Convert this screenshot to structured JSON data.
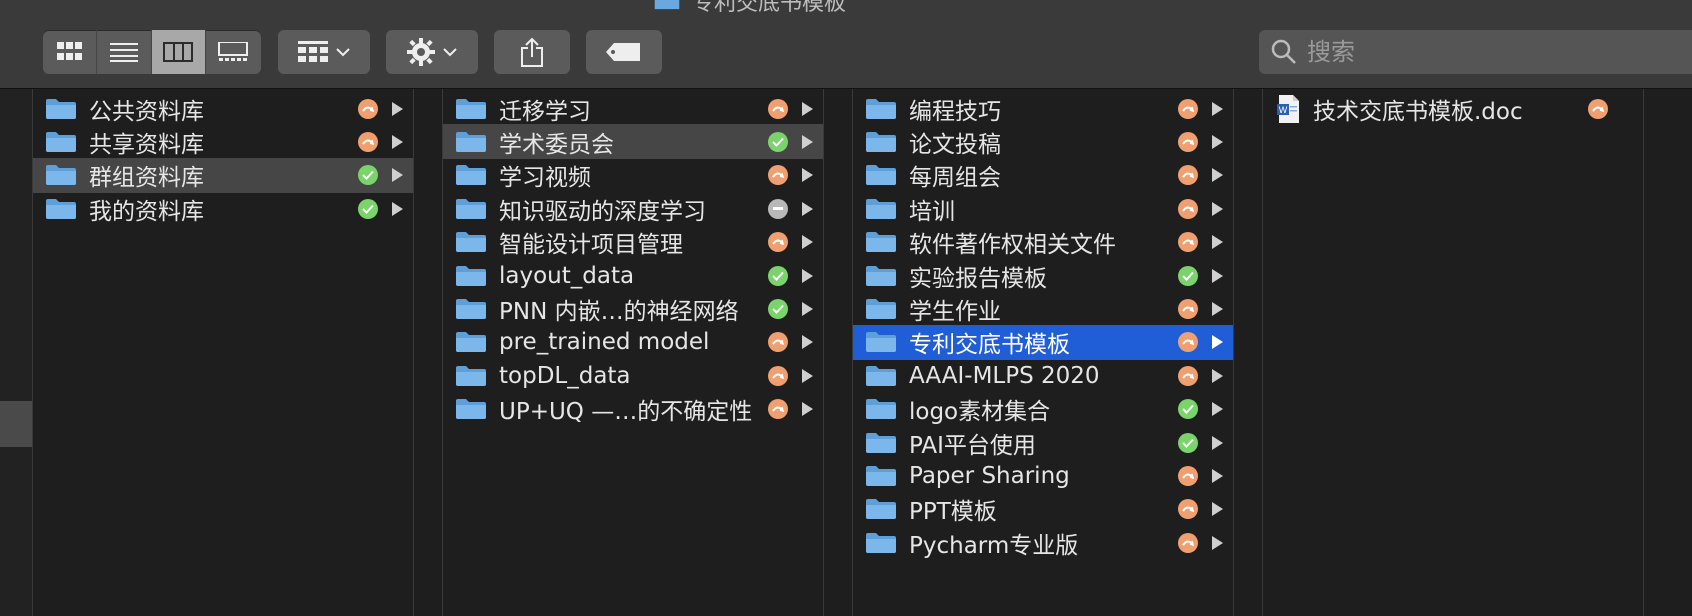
{
  "window": {
    "title": "专利交底书模板"
  },
  "toolbar": {
    "view_buttons": [
      "icon-view",
      "list-view",
      "column-view",
      "gallery-view"
    ],
    "active_view": "column-view",
    "group_button": "group-by",
    "action_button": "action-gear",
    "share_button": "share",
    "tag_button": "tags"
  },
  "search": {
    "placeholder": "搜索"
  },
  "columns": [
    {
      "items": [
        {
          "label": "公共资料库",
          "status": "sync",
          "selected": false
        },
        {
          "label": "共享资料库",
          "status": "sync",
          "selected": false
        },
        {
          "label": "群组资料库",
          "status": "ok",
          "selected": true
        },
        {
          "label": "我的资料库",
          "status": "ok",
          "selected": false
        }
      ]
    },
    {
      "items": [
        {
          "label": "迁移学习",
          "status": "sync",
          "selected": false
        },
        {
          "label": "学术委员会",
          "status": "ok",
          "selected": true
        },
        {
          "label": "学习视频",
          "status": "sync",
          "selected": false
        },
        {
          "label": "知识驱动的深度学习",
          "status": "gray",
          "selected": false
        },
        {
          "label": "智能设计项目管理",
          "status": "sync",
          "selected": false
        },
        {
          "label": "layout_data",
          "status": "ok",
          "selected": false
        },
        {
          "label": "PNN 内嵌…的神经网络",
          "status": "ok",
          "selected": false
        },
        {
          "label": "pre_trained model",
          "status": "sync",
          "selected": false
        },
        {
          "label": "topDL_data",
          "status": "sync",
          "selected": false
        },
        {
          "label": "UP+UQ —…的不确定性",
          "status": "sync",
          "selected": false
        }
      ]
    },
    {
      "items": [
        {
          "label": "编程技巧",
          "status": "sync",
          "selected": false
        },
        {
          "label": "论文投稿",
          "status": "sync",
          "selected": false
        },
        {
          "label": "每周组会",
          "status": "sync",
          "selected": false
        },
        {
          "label": "培训",
          "status": "sync",
          "selected": false
        },
        {
          "label": "软件著作权相关文件",
          "status": "sync",
          "selected": false
        },
        {
          "label": "实验报告模板",
          "status": "ok",
          "selected": false
        },
        {
          "label": "学生作业",
          "status": "sync",
          "selected": false
        },
        {
          "label": "专利交底书模板",
          "status": "sync",
          "selected": "blue"
        },
        {
          "label": "AAAI-MLPS 2020",
          "status": "sync",
          "selected": false
        },
        {
          "label": "logo素材集合",
          "status": "ok",
          "selected": false
        },
        {
          "label": "PAI平台使用",
          "status": "ok",
          "selected": false
        },
        {
          "label": "Paper Sharing",
          "status": "sync",
          "selected": false
        },
        {
          "label": "PPT模板",
          "status": "sync",
          "selected": false
        },
        {
          "label": "Pycharm专业版",
          "status": "sync",
          "selected": false
        }
      ]
    },
    {
      "files": [
        {
          "label": "技术交底书模板.doc",
          "status": "sync",
          "icon": "word-doc-icon"
        }
      ]
    }
  ],
  "colors": {
    "sync": "#f0a070",
    "ok": "#7ad36b",
    "gray": "#b8b8b8",
    "selected_blue": "#1f5ed6",
    "selected_gray": "#464646"
  }
}
